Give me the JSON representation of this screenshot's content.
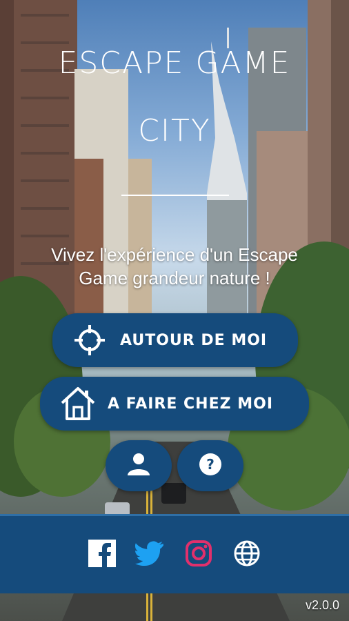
{
  "app": {
    "title_line1": "ESCAPE GAME",
    "title_line2": "CITY",
    "tagline_line1": "Vivez l'expérience d'un Escape",
    "tagline_line2": "Game grandeur nature !"
  },
  "buttons": {
    "around_me": {
      "label": "AUTOUR DE MOI",
      "icon": "crosshair-icon"
    },
    "at_home": {
      "label": "A FAIRE CHEZ MOI",
      "icon": "house-icon"
    },
    "profile": {
      "icon": "user-icon"
    },
    "help": {
      "icon": "question-icon"
    }
  },
  "social": [
    {
      "name": "facebook",
      "icon": "facebook-icon",
      "color": "#ffffff"
    },
    {
      "name": "twitter",
      "icon": "twitter-icon",
      "color": "#1da1f2"
    },
    {
      "name": "instagram",
      "icon": "instagram-icon",
      "color": "#e1306c"
    },
    {
      "name": "website",
      "icon": "globe-icon",
      "color": "#ffffff"
    }
  ],
  "version": "v2.0.0",
  "colors": {
    "primary": "#154b7c",
    "accent_border": "#2f6fa6",
    "text": "#ffffff"
  }
}
